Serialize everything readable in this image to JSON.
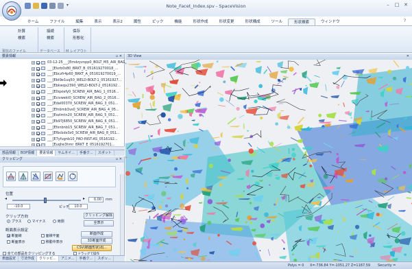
{
  "window": {
    "title": "Note_Facet_Index.spv - SpaceVision"
  },
  "ribbon": {
    "tabs": [
      "ホーム",
      "ファイル",
      "編集",
      "表示",
      "表示2",
      "属性",
      "ピック",
      "機能",
      "形状作成",
      "形状変更",
      "形状構成",
      "ツール",
      "形状検索",
      "ウィンドウ"
    ],
    "active_tab_index": 12,
    "buttons": [
      {
        "label": "計算",
        "sub": "検索"
      },
      {
        "label": "接続",
        "sub": "検索"
      },
      {
        "label": "保存",
        "sub": "形態化"
      }
    ],
    "groups": [
      "現在のファイル",
      "データベース",
      "M レイアウト"
    ]
  },
  "tree": {
    "title": "要素情報",
    "items": [
      "03-12-25___[Emdzyvnpp0_BOLT_M5_AIR_BAG...",
      "___[Elvrb0s80_BRKT_B_051619270018_...",
      "___[Ebczfr4p60_BRKT_A_051619270019_...",
      "___[Ebt9e1uq50_WELD-BOLT-1_05161927...",
      "___[Ebkwqx2390_WELD-BOLT-2_0516192...",
      "___[E0qxiefy0_SCREW_AIR_BAG_1_0516...",
      "___[Ecivwekt0_SCREW_AIR_BAG_2_0516...",
      "___[Edal00370_SCREW_AIR_BAG_3_051...",
      "___[Efnbmb3vs0_SCREW_AIR_BAG_4_05...",
      "___[Eozlmtn20_SCREW_AIR_BAG_5_051...",
      "___[Eb97j6850_SCREW_AIR_BAG_6_051...",
      "___[Efxnbnb15_SCREW_AIR_BAG_7_051...",
      "___[Efbcbdx0z0_SCREW_AIR_BAG_8_051...",
      "___[E7yfugnb10_PAD-INST-AS_0516192...",
      "___[Euqhe3hmr_BRKT_E_0516192701..."
    ]
  },
  "tree_tabs": [
    "部品情報",
    "BOP情報",
    "要素情報",
    "サムネイ...",
    "手番ク...",
    "スポット"
  ],
  "tree_tabs_active": 2,
  "clip": {
    "title": "クリッピング",
    "position_label": "位置",
    "slider_value": "0.00",
    "unit_label": "mm",
    "min_value": "-10.0",
    "pitch_label": "ピッチ",
    "pitch_value": "10.0",
    "direction_label": "クリップ方向",
    "direction_options": [
      "プラス",
      "マイナス",
      "両側"
    ],
    "direction_selected": 0,
    "clip_release_button": "クリッピング解除",
    "show_all_button": "全表示",
    "section_label": "断面表示設定",
    "opt_section_line": "断面線",
    "opt_hatch_plane": "面線平面",
    "opt_section_show": "断面表示",
    "opt_move_show": "移動中表示",
    "section_make_button": "断面作成",
    "section_make_3d_button": "3D断面作成",
    "csv_button": "CSV(断面形状)出...",
    "all_clip_label": "全ての部品をクリッピングする",
    "drag_label": "ドラッグで操作"
  },
  "bottom_tabs": [
    "表面設定",
    "寸法作成",
    "クリッピ...",
    "アニメ...",
    "手番ク...",
    "スポッ..."
  ],
  "bottom_tabs_active": 2,
  "viewport": {
    "title": "3D View"
  },
  "status": {
    "polys": "Polys = 0",
    "coords": "X=-736.84 Y=-1051.27 Z=1187.59",
    "security": "Security = (ISTORE)"
  }
}
